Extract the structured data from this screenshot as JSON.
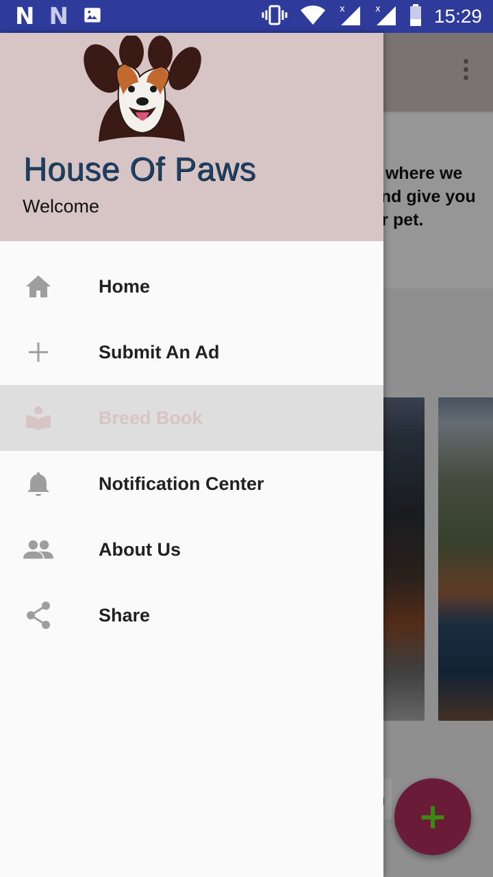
{
  "status_bar": {
    "left_icons": [
      "netflix-n-icon",
      "netflix-n-icon",
      "image-icon"
    ],
    "right_icons": [
      "vibrate-icon",
      "wifi-icon",
      "signal-icon",
      "signal-icon",
      "battery-icon"
    ],
    "time": "15:29",
    "background": "#2e3b9a"
  },
  "background_app": {
    "intro_lines": [
      "e where we",
      "and give you",
      "ur pet."
    ],
    "chip_text": "n",
    "fab_symbol": "+"
  },
  "drawer": {
    "header": {
      "brand_title": "House Of Paws",
      "welcome": "Welcome",
      "background": "#d7c5c5"
    },
    "items": [
      {
        "label": "Home",
        "icon": "home-icon",
        "selected": false
      },
      {
        "label": "Submit An Ad",
        "icon": "plus-icon",
        "selected": false
      },
      {
        "label": "Breed Book",
        "icon": "book-icon",
        "selected": true
      },
      {
        "label": "Notification Center",
        "icon": "bell-icon",
        "selected": false
      },
      {
        "label": "About Us",
        "icon": "people-icon",
        "selected": false
      },
      {
        "label": "Share",
        "icon": "share-icon",
        "selected": false
      }
    ]
  },
  "colors": {
    "accent": "#6a1b37",
    "selected_text": "#d7c5c5",
    "icon_gray": "#9e9e9e"
  }
}
